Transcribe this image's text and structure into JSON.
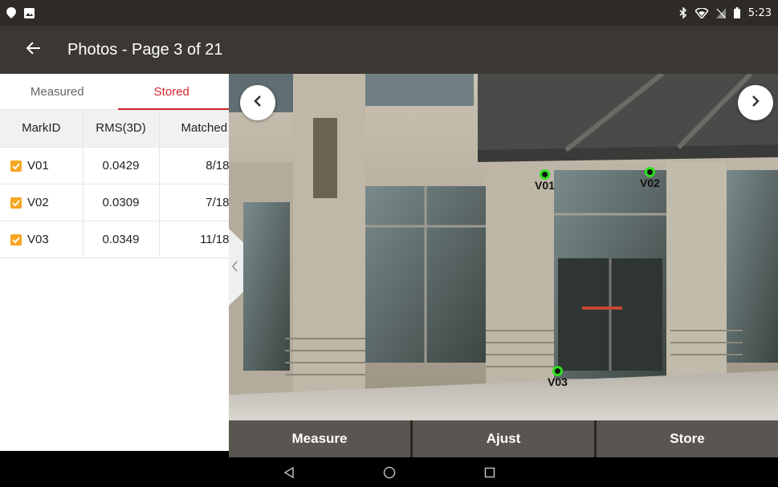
{
  "status_bar": {
    "time": "5:23",
    "left_icons": [
      "location-pin-icon",
      "image-icon"
    ],
    "right_icons": [
      "bluetooth-icon",
      "wifi-icon",
      "no-sim-icon",
      "battery-icon"
    ]
  },
  "app_bar": {
    "back_icon": "arrow-left-icon",
    "title": "Photos - Page 3 of 21"
  },
  "tabs": [
    {
      "label": "Measured",
      "active": false
    },
    {
      "label": "Stored",
      "active": true
    }
  ],
  "table": {
    "columns": [
      "MarkID",
      "RMS(3D)",
      "Matched"
    ],
    "rows": [
      {
        "checked": true,
        "mark": "V01",
        "rms": "0.0429",
        "matched": "8/18"
      },
      {
        "checked": true,
        "mark": "V02",
        "rms": "0.0309",
        "matched": "7/18"
      },
      {
        "checked": true,
        "mark": "V03",
        "rms": "0.0349",
        "matched": "11/18"
      }
    ]
  },
  "photo": {
    "prev_icon": "chevron-left-icon",
    "next_icon": "chevron-right-icon",
    "markers": [
      {
        "label": "V01"
      },
      {
        "label": "V02"
      },
      {
        "label": "V03"
      }
    ]
  },
  "actions": {
    "measure": "Measure",
    "adjust": "Ajust",
    "store": "Store"
  },
  "colors": {
    "accent": "#d0262b",
    "checkbox": "#f5a623",
    "marker": "#2ee01f",
    "app_bar": "#3b3833",
    "button": "#5a5550"
  }
}
